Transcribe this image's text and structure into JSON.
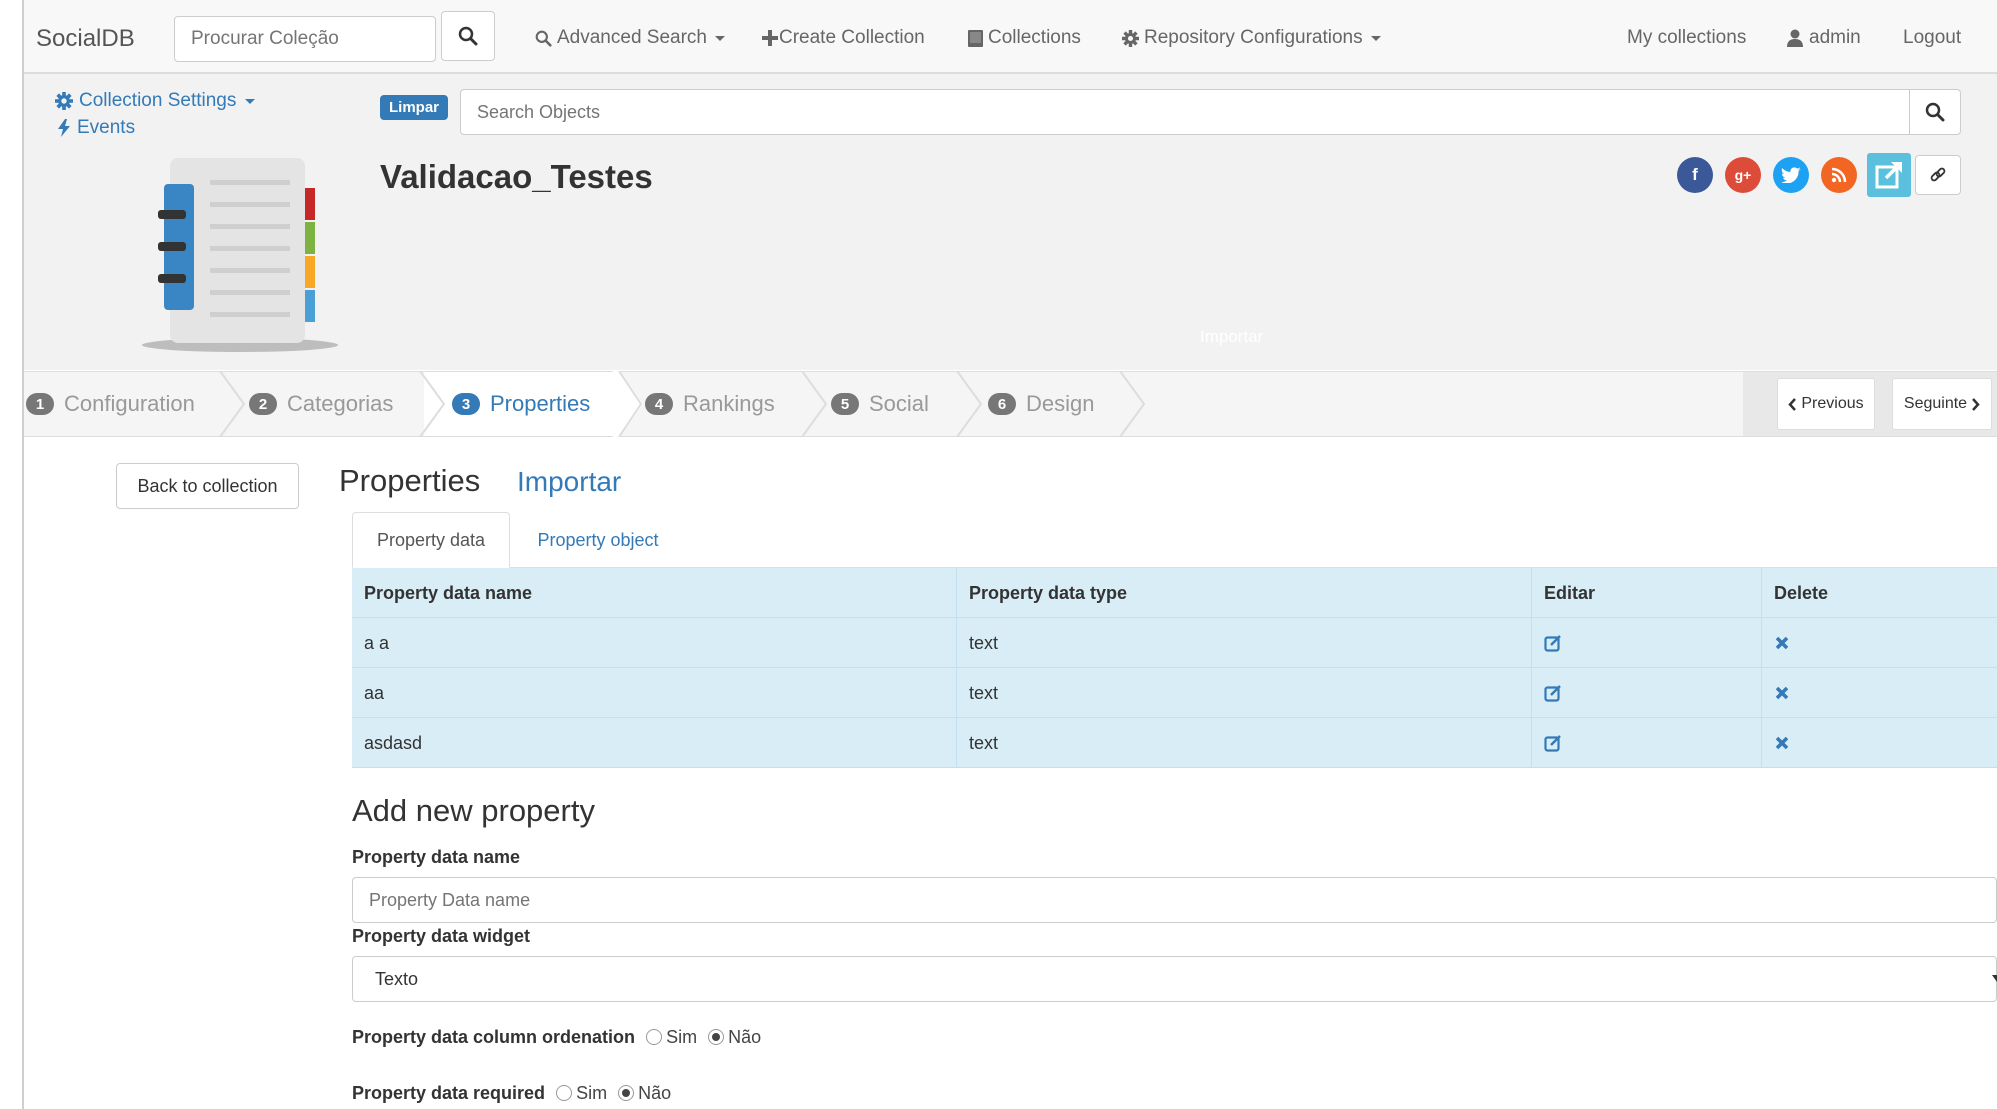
{
  "navbar": {
    "brand": "SocialDB",
    "search_placeholder": "Procurar Coleção",
    "advanced_search": "Advanced Search",
    "create_collection": "Create Collection",
    "collections": "Collections",
    "repo_config": "Repository Configurations",
    "my_collections": "My collections",
    "user": "admin",
    "logout": "Logout"
  },
  "header": {
    "collection_settings": "Collection Settings",
    "events": "Events",
    "limpar": "Limpar",
    "search_placeholder": "Search Objects",
    "title": "Validacao_Testes",
    "hidden_import": "Importar"
  },
  "social": {
    "facebook": "f",
    "google": "g+",
    "twitter": "t",
    "rss": "rss"
  },
  "wizard": {
    "steps": [
      {
        "num": "1",
        "label": "Configuration"
      },
      {
        "num": "2",
        "label": "Categorias"
      },
      {
        "num": "3",
        "label": "Properties"
      },
      {
        "num": "4",
        "label": "Rankings"
      },
      {
        "num": "5",
        "label": "Social"
      },
      {
        "num": "6",
        "label": "Design"
      }
    ],
    "active_step": 3,
    "previous": "Previous",
    "next": "Seguinte"
  },
  "main": {
    "back_button": "Back to collection",
    "title": "Properties",
    "import_link": "Importar",
    "tabs": [
      "Property data",
      "Property object"
    ]
  },
  "table": {
    "headers": [
      "Property data name",
      "Property data type",
      "Editar",
      "Delete"
    ],
    "rows": [
      {
        "name": "a a",
        "type": "text"
      },
      {
        "name": "aa",
        "type": "text"
      },
      {
        "name": "asdasd",
        "type": "text"
      }
    ]
  },
  "form": {
    "title": "Add new property",
    "name_label": "Property data name",
    "name_placeholder": "Property Data name",
    "widget_label": "Property data widget",
    "widget_value": "Texto",
    "ordenation_label": "Property data column ordenation",
    "required_label": "Property data required",
    "opt_yes": "Sim",
    "opt_no": "Não"
  },
  "colors": {
    "link": "#337ab7",
    "table_bg": "#d9edf7",
    "facebook": "#3b5998",
    "google": "#dd4b39",
    "twitter": "#1da1f2",
    "rss": "#f26522",
    "share": "#5bc0de"
  }
}
